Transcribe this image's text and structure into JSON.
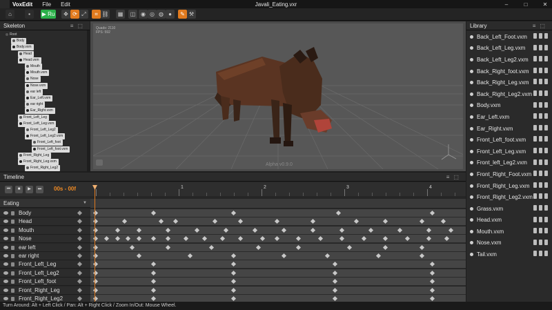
{
  "app": {
    "name": "VoxEdit",
    "menu": [
      "File",
      "Edit"
    ],
    "title": "Javali_Eating.vxr",
    "window_controls": [
      "–",
      "□",
      "✕"
    ]
  },
  "toolbar": {
    "play_label": "▶ Ru",
    "icons": [
      "home-icon",
      "save-icon",
      "play-toggle",
      "move-icon",
      "rotate-icon",
      "scale-icon",
      "bone-icon",
      "link-icon",
      "grid-icon",
      "select-icon",
      "paint-icon",
      "erase-icon",
      "sphere-icon",
      "brush-icon",
      "wand-icon",
      "tools-icon"
    ]
  },
  "skeleton": {
    "title": "Skeleton",
    "nodes": [
      {
        "label": "Root",
        "type": "root"
      },
      {
        "label": "Body",
        "type": "bone"
      },
      {
        "label": "Body.vxm",
        "type": "file"
      },
      {
        "label": "Head",
        "type": "bone"
      },
      {
        "label": "Head.vxm",
        "type": "file"
      },
      {
        "label": "Mouth",
        "type": "bone"
      },
      {
        "label": "Mouth.vxm",
        "type": "file"
      },
      {
        "label": "Nose",
        "type": "bone"
      },
      {
        "label": "Nose.vxm",
        "type": "file"
      },
      {
        "label": "ear left",
        "type": "bone"
      },
      {
        "label": "Ear_Left.vxm",
        "type": "file"
      },
      {
        "label": "ear right",
        "type": "bone"
      },
      {
        "label": "Ear_Right.vxm",
        "type": "file"
      },
      {
        "label": "Front_Left_Leg",
        "type": "bone"
      },
      {
        "label": "Front_Left_Leg.vxm",
        "type": "file"
      },
      {
        "label": "Front_Left_Leg2",
        "type": "bone"
      },
      {
        "label": "Front_Left_Leg2.vxm",
        "type": "file"
      },
      {
        "label": "Front_Left_foot",
        "type": "bone"
      },
      {
        "label": "Front_Left_foot.vxm",
        "type": "file"
      },
      {
        "label": "Front_Right_Leg",
        "type": "bone"
      },
      {
        "label": "Front_Right_Leg.vxm",
        "type": "file"
      },
      {
        "label": "Front_Right_Leg2",
        "type": "bone"
      }
    ]
  },
  "viewport": {
    "stats_line1": "Quads: 2110",
    "stats_line2": "FPS: 592",
    "watermark": "Alpha v0.9.0",
    "colors": {
      "background": "#555555",
      "grid": "#6a6a6a",
      "boar_dark": "#3a2418",
      "boar_mid": "#5a3422",
      "boar_light": "#6e4028",
      "snout": "#b0443a"
    }
  },
  "library": {
    "title": "Library",
    "items": [
      "Back_Left_Foot.vxm",
      "Back_Left_Leg.vxm",
      "Back_Left_Leg2.vxm",
      "Back_Right_foot.vxm",
      "Back_Right_Leg.vxm",
      "Back_Right_Leg2.vxm",
      "Body.vxm",
      "Ear_Left.vxm",
      "Ear_Right.vxm",
      "Front_Left_foot.vxm",
      "Front_Left_Leg.vxm",
      "Front_left_Leg2.vxm",
      "Front_Right_Foot.vxm",
      "Front_Right_Leg.vxm",
      "Front_Right_Leg2.vxm",
      "Grass.vxm",
      "Head.vxm",
      "Mouth.vxm",
      "Nose.vxm",
      "Tail.vxm"
    ]
  },
  "timeline": {
    "title": "Timeline",
    "current_time": "00s - 00f",
    "ruler_labels": [
      "1",
      "2",
      "3",
      "4"
    ],
    "animation": "Eating",
    "accent": "#e07a1e",
    "tracks": [
      {
        "name": "Body",
        "keys": [
          0.0,
          0.16,
          0.38,
          0.67,
          0.93
        ]
      },
      {
        "name": "Head",
        "keys": [
          0.0,
          0.08,
          0.18,
          0.22,
          0.33,
          0.4,
          0.5,
          0.6,
          0.72,
          0.8,
          0.9,
          0.96
        ]
      },
      {
        "name": "Mouth",
        "keys": [
          0.0,
          0.06,
          0.12,
          0.2,
          0.28,
          0.36,
          0.44,
          0.52,
          0.6,
          0.68,
          0.76,
          0.84,
          0.92,
          0.98
        ]
      },
      {
        "name": "Nose",
        "keys": [
          0.0,
          0.03,
          0.06,
          0.09,
          0.12,
          0.16,
          0.2,
          0.25,
          0.3,
          0.35,
          0.4,
          0.46,
          0.5,
          0.56,
          0.62,
          0.68,
          0.74,
          0.8,
          0.86,
          0.92,
          0.97
        ]
      },
      {
        "name": "ear left",
        "keys": [
          0.0,
          0.1,
          0.2,
          0.32,
          0.45,
          0.56,
          0.7,
          0.8,
          0.9
        ]
      },
      {
        "name": "ear right",
        "keys": [
          0.0,
          0.12,
          0.26,
          0.38,
          0.52,
          0.64,
          0.78,
          0.9
        ]
      },
      {
        "name": "Front_Left_Leg",
        "keys": [
          0.0,
          0.16,
          0.38,
          0.66,
          0.93
        ]
      },
      {
        "name": "Front_Left_Leg2",
        "keys": [
          0.0,
          0.16,
          0.38,
          0.66,
          0.93
        ]
      },
      {
        "name": "Front_Left_foot",
        "keys": [
          0.0,
          0.16,
          0.38,
          0.66,
          0.93
        ]
      },
      {
        "name": "Front_Right_Leg",
        "keys": [
          0.0,
          0.16,
          0.38,
          0.66,
          0.93
        ]
      },
      {
        "name": "Front_Right_Leg2",
        "keys": [
          0.0,
          0.16,
          0.38,
          0.66,
          0.93
        ]
      }
    ]
  },
  "status": {
    "hint": "Turn Around: Alt + Left Click / Pan: Alt + Right Click / Zoom In/Out: Mouse Wheel."
  }
}
